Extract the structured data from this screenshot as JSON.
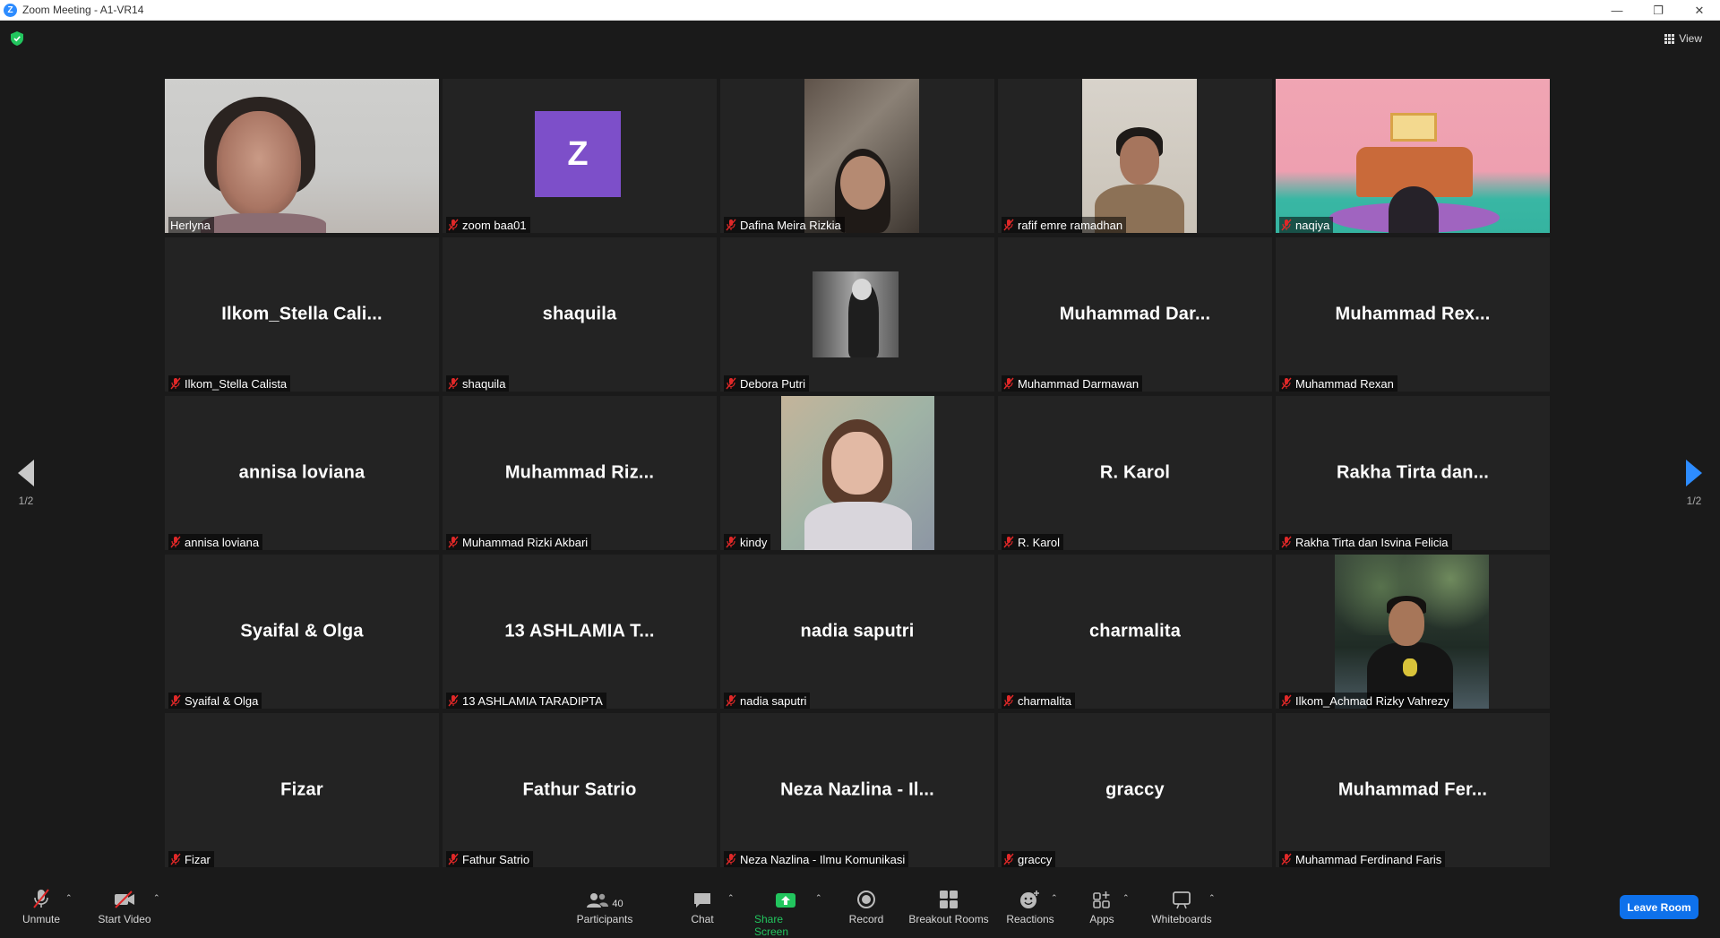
{
  "window": {
    "title": "Zoom Meeting - A1-VR14",
    "app_icon_letter": "Z",
    "controls": {
      "minimize": "—",
      "restore": "❐",
      "close": "✕"
    }
  },
  "top_bar": {
    "view_label": "View"
  },
  "pagination": {
    "left_label": "1/2",
    "right_label": "1/2"
  },
  "participants": [
    {
      "display": "",
      "label": "Herlyna",
      "video": "herlyna",
      "active": true,
      "muted": false
    },
    {
      "display": "",
      "label": "zoom baa01",
      "avatar_letter": "Z",
      "muted": true
    },
    {
      "display": "",
      "label": "Dafina Meira Rizkia",
      "video": "dafina",
      "muted": true
    },
    {
      "display": "",
      "label": "rafif emre ramadhan",
      "video": "rafif",
      "muted": true
    },
    {
      "display": "",
      "label": "naqiya",
      "video": "naqiya",
      "muted": true
    },
    {
      "display": "Ilkom_Stella  Cali...",
      "label": "Ilkom_Stella Calista",
      "muted": true
    },
    {
      "display": "shaquila",
      "label": "shaquila",
      "muted": true
    },
    {
      "display": "",
      "label": "Debora Putri",
      "video": "debora",
      "muted": true
    },
    {
      "display": "Muhammad  Dar...",
      "label": "Muhammad Darmawan",
      "muted": true
    },
    {
      "display": "Muhammad  Rex...",
      "label": "Muhammad Rexan",
      "muted": true
    },
    {
      "display": "annisa loviana",
      "label": "annisa loviana",
      "muted": true
    },
    {
      "display": "Muhammad  Riz...",
      "label": "Muhammad Rizki Akbari",
      "muted": true
    },
    {
      "display": "",
      "label": "kindy",
      "video": "kindy",
      "muted": true
    },
    {
      "display": "R. Karol",
      "label": "R. Karol",
      "muted": true
    },
    {
      "display": "Rakha Tirta dan...",
      "label": "Rakha Tirta dan Isvina Felicia",
      "muted": true
    },
    {
      "display": "Syaifal & Olga",
      "label": "Syaifal & Olga",
      "muted": true
    },
    {
      "display": "13  ASHLAMIA  T...",
      "label": "13 ASHLAMIA TARADIPTA",
      "muted": true
    },
    {
      "display": "nadia saputri",
      "label": "nadia saputri",
      "muted": true
    },
    {
      "display": "charmalita",
      "label": "charmalita",
      "muted": true
    },
    {
      "display": "",
      "label": "Ilkom_Achmad Rizky Vahrezy",
      "video": "achmad",
      "muted": true
    },
    {
      "display": "Fizar",
      "label": "Fizar",
      "muted": true
    },
    {
      "display": "Fathur Satrio",
      "label": "Fathur Satrio",
      "muted": true
    },
    {
      "display": "Neza Nazlina - Il...",
      "label": "Neza Nazlina - Ilmu Komunikasi",
      "muted": true
    },
    {
      "display": "graccy",
      "label": "graccy",
      "muted": true
    },
    {
      "display": "Muhammad  Fer...",
      "label": "Muhammad Ferdinand Faris",
      "muted": true
    }
  ],
  "toolbar": {
    "unmute": "Unmute",
    "start_video": "Start Video",
    "participants": "Participants",
    "participants_count": "40",
    "chat": "Chat",
    "share_screen": "Share Screen",
    "record": "Record",
    "breakout_rooms": "Breakout Rooms",
    "reactions": "Reactions",
    "apps": "Apps",
    "whiteboards": "Whiteboards",
    "leave_room": "Leave Room"
  },
  "colors": {
    "background": "#1a1a1a",
    "tile": "#232323",
    "active_speaker_border": "#c9ea6b",
    "share_green": "#22c55e",
    "leave_blue": "#0e71eb",
    "mute_red": "#e02828",
    "avatar_purple": "#7d4fc9"
  }
}
